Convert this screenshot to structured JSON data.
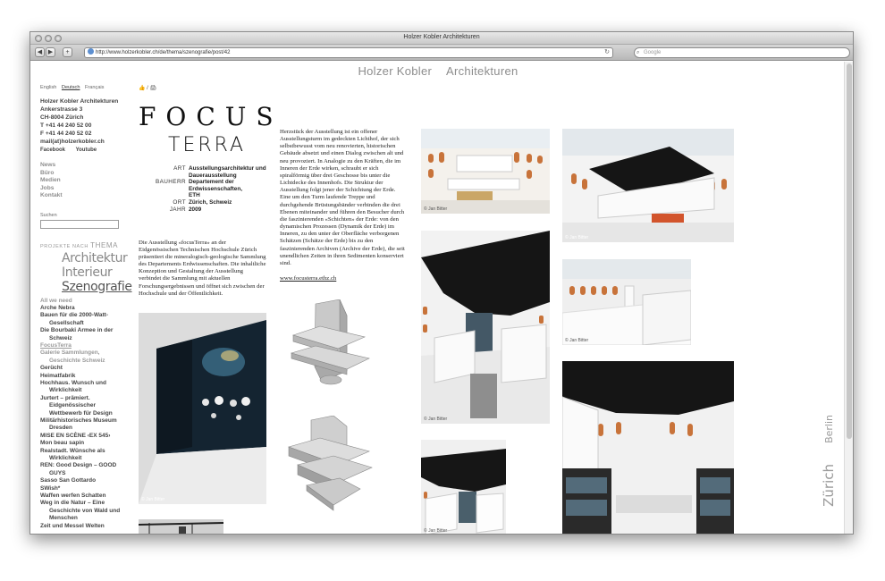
{
  "browser": {
    "window_title": "Holzer Kobler Architekturen",
    "url": "http://www.holzerkobler.ch/de/thema/szenografie/post/42",
    "search_placeholder": "Google",
    "back_label": "◀",
    "forward_label": "▶",
    "add_label": "+"
  },
  "site": {
    "brand_left": "Holzer Kobler",
    "brand_right": "Architekturen"
  },
  "sidebar": {
    "languages": [
      "English",
      "Deutsch",
      "Français"
    ],
    "active_language": "Deutsch",
    "company": "Holzer Kobler Architekturen",
    "street": "Ankerstrasse 3",
    "city": "CH-8004 Zürich",
    "phone": "T +41 44 240 52 00",
    "fax": "F +41 44 240 52 02",
    "email": "mail(at)holzerkobler.ch",
    "social": [
      "Facebook",
      "Youtube"
    ],
    "nav": [
      "News",
      "Büro",
      "Medien",
      "Jobs",
      "Kontakt"
    ],
    "search_label": "Suchen",
    "projects_prefix": "PROJEKTE NACH",
    "projects_word": "THEMA",
    "categories": [
      "Architektur",
      "Interieur",
      "Szenografie"
    ],
    "projects": [
      "All we need",
      "Arche Nebra",
      "Bauen für die 2000-Watt-",
      "Gesellschaft",
      "Die Bourbaki Armee in der",
      "Schweiz",
      "FocusTerra",
      "Galerie Sammlungen,",
      "Geschichte Schweiz",
      "Gerücht",
      "Heimatfabrik",
      "Hochhaus. Wunsch und",
      "Wirklichkeit",
      "Jurtert – prämiert.",
      "Eidgenössischer",
      "Wettbewerb für Design",
      "Militärhistorisches Museum",
      "Dresden",
      "MISE EN SCÈNE ‹EX 545›",
      "Mon beau sapin",
      "Realstadt. Wünsche als",
      "Wirklichkeit",
      "REN: Good Design – GOOD",
      "GUYS",
      "Sasso San Gottardo",
      "SWish*",
      "Waffen werfen Schatten",
      "Weg in die Natur – Eine",
      "Geschichte von Wald und",
      "Menschen",
      "Zeit und Messel Welten"
    ]
  },
  "article": {
    "icons_label": "👍 / 🖨",
    "title_1": "FOCUS",
    "title_2": "TERRA",
    "meta": [
      {
        "key": "ART",
        "value": "Ausstellungsarchitektur und"
      },
      {
        "key": "",
        "value": "Dauerausstellung"
      },
      {
        "key": "BAUHERR",
        "value": "Departement der Erdwissenschaften,"
      },
      {
        "key": "",
        "value": "ETH"
      },
      {
        "key": "ORT",
        "value": "Zürich, Schweiz"
      },
      {
        "key": "JAHR",
        "value": "2009"
      }
    ],
    "intro": "Die Ausstellung «focusTerra» an der Eidgenössischen Technischen Hochschule Zürich präsentiert die mineralogisch-geologische Sammlung des Departements Erdwissenschaften. Die inhaltliche Konzeption und Gestaltung der Ausstellung verbindet die Sammlung mit aktuellen Forschungsergebnissen und öffnet sich zwischen der Hochschule und der Öffentlichkeit.",
    "body": "Herzstück der Ausstellung ist ein offener Ausstellungsturm im gedeckten Lichthof, der sich selbstbewusst vom neu renovierten, historischen Gebäude absetzt und einen Dialog zwischen alt und neu provoziert. In Analogie zu den Kräften, die im Inneren der Erde wirken, schraubt er sich spiralförmig über drei Geschosse bis unter die Lichtdecke des Innenhofs. Die Struktur der Ausstellung folgt jener der Schichtung der Erde. Eine um den Turm laufende Treppe und durchgehende Brüstungsbänder verbinden die drei Ebenen miteinander und führen den Besucher durch die faszinierenden «Schichten» der Erde: von den dynamischen Prozessen (Dynamik der Erde) im Inneren, zu den unter der Oberfläche verborgenen Schätzen (Schätze der Erde) bis zu den faszinierenden Archiven (Archive der Erde), die seit unendlichen Zeiten in ihren Sedimenten konserviert sind.",
    "link": "www.focusterra.ethz.ch"
  },
  "photos": {
    "credit": "© Jan Bitter"
  },
  "cities": [
    "Zürich",
    "Berlin"
  ],
  "colors": {
    "accent_gray": "#8d8d8d",
    "ceiling_black": "#151515",
    "gallery_orange": "#c8733a"
  }
}
